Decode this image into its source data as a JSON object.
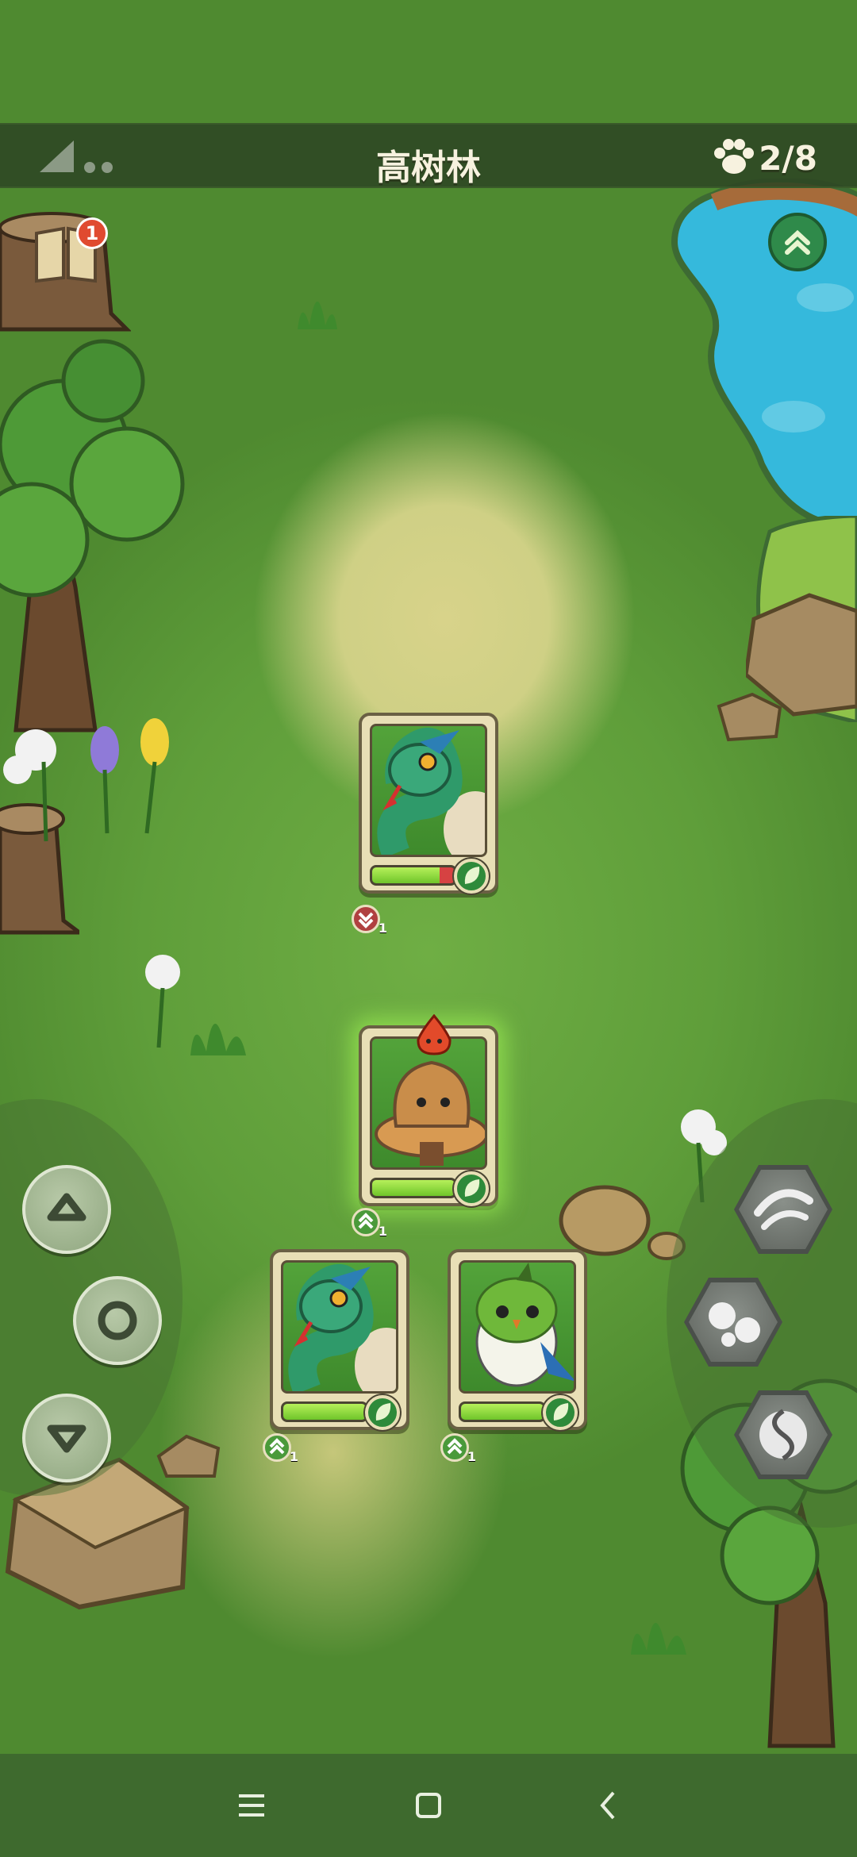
{
  "header": {
    "location_title": "高树林",
    "party_count": "2/8",
    "paw-icon": "paw-icon",
    "signal-icon": "signal-triangle-icon"
  },
  "journal": {
    "notification_count": "1",
    "icon": "book-icon"
  },
  "map": {
    "expand_icon": "double-chevron-up-icon"
  },
  "enemy_card": {
    "creature": "green snake",
    "element": "leaf",
    "hp_fraction": 0.82,
    "level_badge": "1"
  },
  "player_cards": [
    {
      "creature": "mushroom",
      "element": "leaf",
      "hp_fraction": 1.0,
      "level_badge": "1",
      "status_icon": "fire-spirit-icon",
      "selected": true
    },
    {
      "creature": "green snake",
      "element": "leaf",
      "hp_fraction": 1.0,
      "level_badge": "1"
    },
    {
      "creature": "green parrot",
      "element": "leaf",
      "hp_fraction": 1.0,
      "level_badge": "1"
    }
  ],
  "controls": {
    "left": [
      "triangle-up-icon",
      "circle-icon",
      "triangle-down-icon"
    ],
    "right": [
      "wind-skill-icon",
      "bubbles-skill-icon",
      "swirl-skill-icon"
    ]
  },
  "navbar": [
    "menu-icon",
    "home-square-icon",
    "back-chevron-icon"
  ]
}
